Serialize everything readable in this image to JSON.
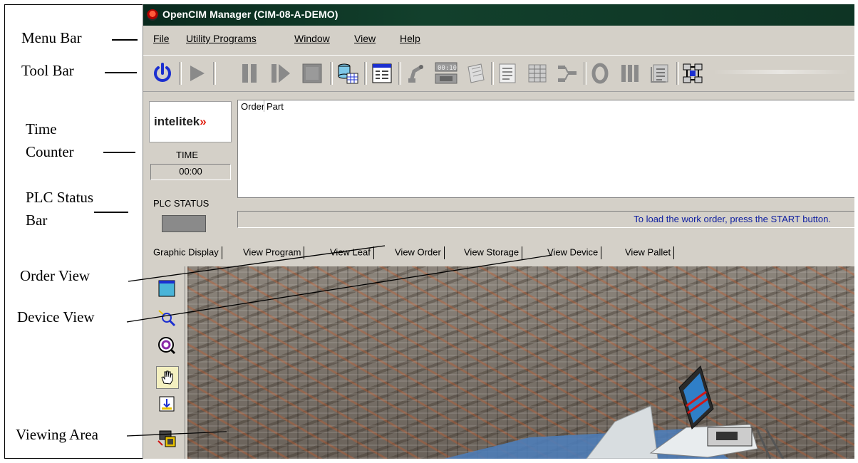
{
  "window": {
    "title": "OpenCIM Manager (CIM-08-A-DEMO)"
  },
  "menu": {
    "items": [
      "File",
      "Utility Programs",
      "Window",
      "View",
      "Help"
    ]
  },
  "toolbar": {
    "buttons": [
      {
        "icon": "power-icon"
      },
      {
        "icon": "play-icon"
      },
      {
        "icon": "pause-icon"
      },
      {
        "icon": "step-icon"
      },
      {
        "icon": "stop-icon"
      },
      {
        "icon": "database-icon"
      },
      {
        "icon": "form-icon"
      },
      {
        "icon": "robot-arm-icon"
      },
      {
        "icon": "timer-icon"
      },
      {
        "icon": "notebook-icon"
      },
      {
        "icon": "document-icon"
      },
      {
        "icon": "grid-icon"
      },
      {
        "icon": "flow-icon"
      },
      {
        "icon": "ring-icon"
      },
      {
        "icon": "columns-icon"
      },
      {
        "icon": "report-icon"
      },
      {
        "icon": "network-icon"
      }
    ]
  },
  "status": {
    "logo_text": "intelitek",
    "logo_arrows": "»",
    "time_label": "TIME",
    "time_value": "00:00",
    "plc_label": "PLC STATUS",
    "order_columns": [
      "Order",
      "Part"
    ],
    "message": "To load the work order, press the START button."
  },
  "tabs": [
    "Graphic Display",
    "View Program",
    "View Leaf",
    "View Order",
    "View Storage",
    "View Device",
    "View Pallet"
  ],
  "graphic_tools": [
    "window-icon",
    "zoom-icon",
    "rotate-icon",
    "hand-icon",
    "pan-icon",
    "camera-icon"
  ],
  "annotations": {
    "menu_bar": "Menu Bar",
    "tool_bar": "Tool Bar",
    "time_counter_1": "Time",
    "time_counter_2": "Counter",
    "plc_1": "PLC Status",
    "plc_2": "Bar",
    "order_view": "Order View",
    "device_view": "Device View",
    "viewing_area": "Viewing Area"
  },
  "colors": {
    "title_bar": "#12402c",
    "window_bg": "#d4d0c8",
    "power_icon": "#1b2fd0",
    "message_text": "#1020a0"
  }
}
